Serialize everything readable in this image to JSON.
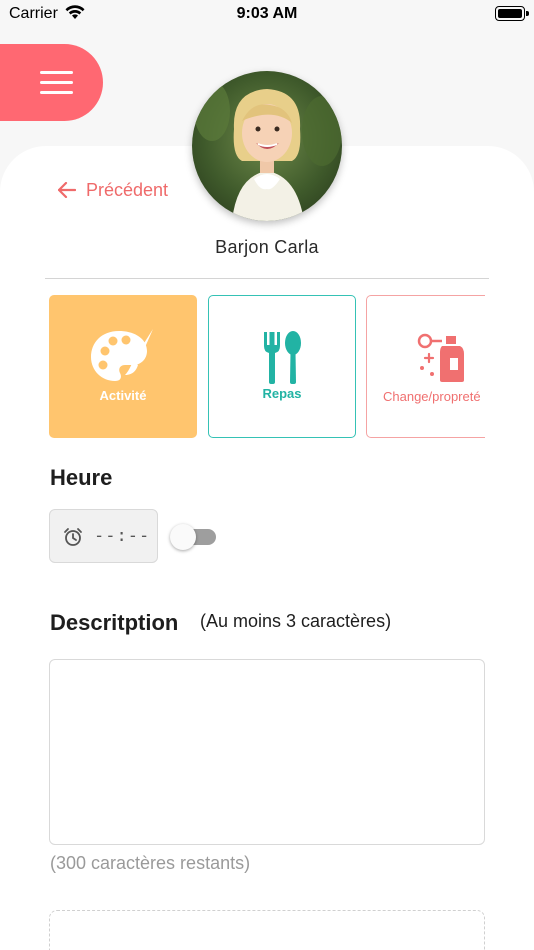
{
  "status_bar": {
    "carrier": "Carrier",
    "time": "9:03 AM"
  },
  "icons": {
    "menu": "hamburger-icon",
    "back": "arrow-left-icon",
    "activity": "palette-icon",
    "meal": "fork-spoon-icon",
    "change": "cleaning-spray-icon",
    "time": "alarm-clock-icon"
  },
  "colors": {
    "accent": "#ff6872",
    "activity_tile": "#ffc56e",
    "meal_border": "#35c2b5",
    "change_border": "#f5a3a3"
  },
  "header": {
    "back_label": "Précédent"
  },
  "child": {
    "name": "Barjon Carla"
  },
  "categories": [
    {
      "label": "Activité",
      "selected": true
    },
    {
      "label": "Repas",
      "selected": false
    },
    {
      "label": "Change/propreté",
      "selected": false
    }
  ],
  "time_section": {
    "title": "Heure",
    "value": "--:--",
    "toggle_on": false
  },
  "description": {
    "title": "Descritption",
    "hint": "(Au moins 3 caractères)",
    "value": "",
    "remaining": "(300 caractères restants)"
  }
}
